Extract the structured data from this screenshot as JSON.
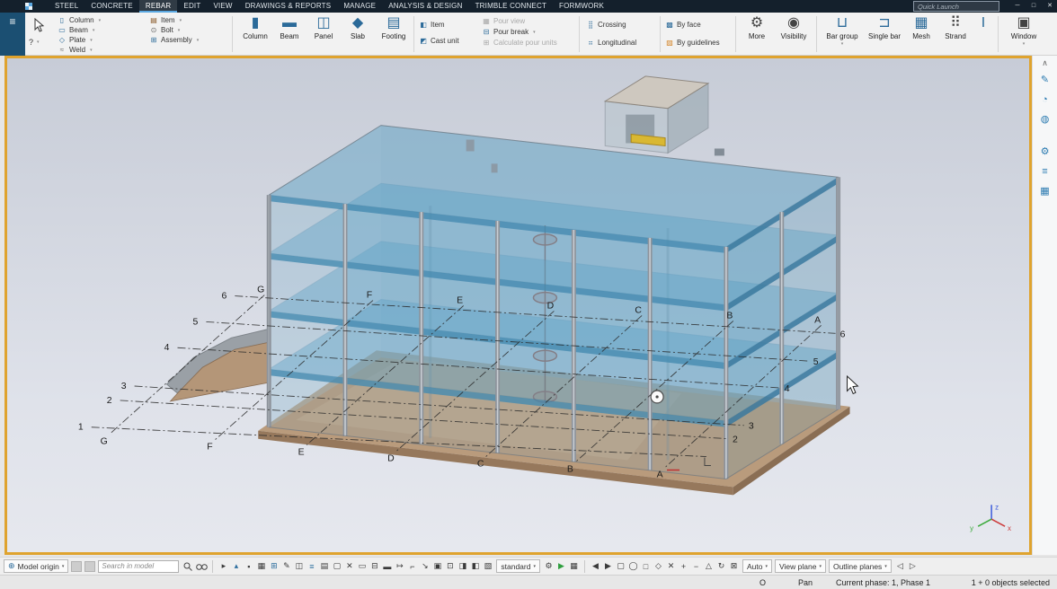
{
  "titlebar": {
    "tabs": [
      "STEEL",
      "CONCRETE",
      "REBAR",
      "EDIT",
      "VIEW",
      "DRAWINGS & REPORTS",
      "MANAGE",
      "ANALYSIS & DESIGN",
      "TRIMBLE CONNECT",
      "FORMWORK"
    ],
    "active_tab": "REBAR",
    "quick_launch_placeholder": "Quick Launch",
    "window_controls": {
      "minimize": "─",
      "maximize": "□",
      "close": "✕"
    }
  },
  "ribbon": {
    "help_label": "?",
    "component_items": [
      {
        "label": "Column",
        "glyph": "▯"
      },
      {
        "label": "Beam",
        "glyph": "▭"
      },
      {
        "label": "Plate",
        "glyph": "◇"
      },
      {
        "label": "Weld",
        "glyph": "≈"
      }
    ],
    "detail_items": [
      {
        "label": "Item",
        "glyph": "▤"
      },
      {
        "label": "Bolt",
        "glyph": "⊙"
      },
      {
        "label": "Assembly",
        "glyph": "⊞"
      }
    ],
    "create_buttons": [
      {
        "label": "Column",
        "glyph": "▮"
      },
      {
        "label": "Beam",
        "glyph": "▬"
      },
      {
        "label": "Panel",
        "glyph": "◫"
      },
      {
        "label": "Slab",
        "glyph": "◆"
      },
      {
        "label": "Footing",
        "glyph": "▤"
      }
    ],
    "cast_buttons": [
      {
        "label": "Item",
        "glyph": "◧"
      },
      {
        "label": "Cast unit",
        "glyph": "◩"
      }
    ],
    "pour_buttons": [
      {
        "label": "Pour view",
        "glyph": "▦",
        "disabled": true
      },
      {
        "label": "Pour break",
        "glyph": "⊟",
        "disabled": false
      },
      {
        "label": "Calculate pour units",
        "glyph": "⊞",
        "disabled": true
      }
    ],
    "direction_buttons": [
      {
        "label": "Crossing",
        "glyph": "⣿"
      },
      {
        "label": "Longitudinal",
        "glyph": "⠶"
      }
    ],
    "method_buttons": [
      {
        "label": "By face",
        "glyph": "▩"
      },
      {
        "label": "By guidelines",
        "glyph": "▨"
      }
    ],
    "misc_buttons": [
      {
        "label": "More",
        "glyph": "⚙"
      },
      {
        "label": "Visibility",
        "glyph": "◉"
      }
    ],
    "rebar_buttons": [
      {
        "label": "Bar group",
        "glyph": "⊔"
      },
      {
        "label": "Single bar",
        "glyph": "⊐"
      },
      {
        "label": "Mesh",
        "glyph": "▦"
      },
      {
        "label": "Strand",
        "glyph": "⠿"
      }
    ],
    "window_button": {
      "label": "Window",
      "glyph": "▣"
    }
  },
  "viewport": {
    "grid": {
      "letters": [
        "G",
        "F",
        "E",
        "D",
        "C",
        "B",
        "A"
      ],
      "numbers": [
        "6",
        "5",
        "4",
        "3",
        "2",
        "1"
      ]
    },
    "axis": {
      "x": "x",
      "y": "y",
      "z": "z"
    }
  },
  "right_rail": {
    "scroll_up": "∧",
    "pen": "✎",
    "compass": "◔",
    "globe": "◍",
    "gear": "⚙",
    "list": "≡",
    "grid": "▦"
  },
  "bottom_toolbar": {
    "origin_glyph": "⊕",
    "model_origin_label": "Model origin",
    "search_placeholder": "Search in model",
    "standard_label": "standard",
    "auto_label": "Auto",
    "view_plane_label": "View plane",
    "outline_planes_label": "Outline planes",
    "select_tools": [
      "▸",
      "▴",
      "▪",
      "▦",
      "⊞",
      "✎",
      "◫",
      "≡",
      "▤",
      "▢",
      "✕",
      "▭",
      "⊟",
      "▬",
      "↦",
      "⌐",
      "↘",
      "▣",
      "⊡",
      "◨",
      "◧",
      "▧"
    ],
    "post_standard_tools": [
      "⚙",
      "▶",
      "▦"
    ],
    "view_tools": [
      "◀",
      "▶",
      "▢",
      "◯",
      "□",
      "◇",
      "✕",
      "+",
      "−",
      "△",
      "↻",
      "⊠"
    ],
    "nav_arrows": [
      "◁",
      "▷"
    ]
  },
  "statusbar": {
    "ortho": "O",
    "pan": "Pan",
    "phase": "Current phase: 1, Phase 1",
    "selection": "1 + 0 objects selected"
  }
}
